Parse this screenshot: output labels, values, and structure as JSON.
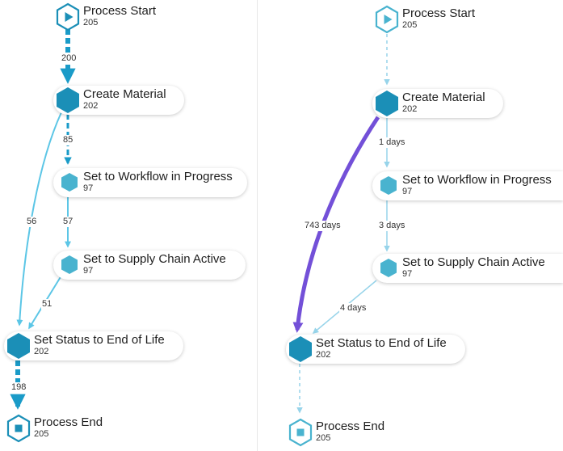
{
  "left_panel": {
    "nodes": {
      "process_start": {
        "label": "Process Start",
        "count": "205"
      },
      "create_material": {
        "label": "Create Material",
        "count": "202"
      },
      "workflow_in_progress": {
        "label": "Set to Workflow in Progress",
        "count": "97"
      },
      "supply_chain_active": {
        "label": "Set to Supply Chain Active",
        "count": "97"
      },
      "end_of_life": {
        "label": "Set Status to End of Life",
        "count": "202"
      },
      "process_end": {
        "label": "Process End",
        "count": "205"
      }
    },
    "edges": {
      "start_to_create": "200",
      "create_to_workflow": "85",
      "create_to_eol": "56",
      "workflow_to_supply": "57",
      "supply_to_eol": "51",
      "eol_to_end": "198"
    }
  },
  "right_panel": {
    "nodes": {
      "process_start": {
        "label": "Process Start",
        "count": "205"
      },
      "create_material": {
        "label": "Create Material",
        "count": "202"
      },
      "workflow_in_progress": {
        "label": "Set to Workflow in Progress",
        "count": "97"
      },
      "supply_chain_active": {
        "label": "Set to Supply Chain Active",
        "count": "97"
      },
      "end_of_life": {
        "label": "Set Status to End of Life",
        "count": "202"
      },
      "process_end": {
        "label": "Process End",
        "count": "205"
      }
    },
    "edges": {
      "create_to_workflow": "1 days",
      "create_to_eol": "743 days",
      "workflow_to_supply": "3 days",
      "supply_to_eol": "4 days"
    }
  },
  "colors": {
    "dark_node": "#1b8fb7",
    "light_node": "#49b3cf",
    "edge_strong": "#1a9bc8",
    "edge_light": "#5cc6e6",
    "edge_faint": "#97d4ea",
    "edge_highlight": "#7350d8"
  }
}
